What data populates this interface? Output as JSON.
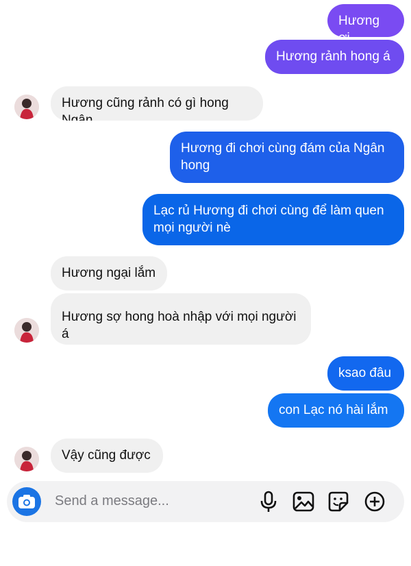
{
  "messages": [
    {
      "side": "out",
      "text": "Hương ơi",
      "color": "#7a4bf2"
    },
    {
      "side": "out",
      "text": "Hương rảnh hong á",
      "color": "#6f4cf0"
    },
    {
      "side": "in",
      "text": "Hương cũng rảnh có gì hong Ngân",
      "color": "#f0f0f0"
    },
    {
      "side": "out",
      "text": "Hương đi chơi cùng đám của Ngân hong",
      "color": "#1e60ea"
    },
    {
      "side": "out",
      "text": "Lạc rủ Hương đi chơi cùng để làm quen mọi người nè",
      "color": "#0a66e8"
    },
    {
      "side": "in",
      "text": "Hương ngại lắm",
      "color": "#f0f0f0"
    },
    {
      "side": "in",
      "text": "Hương sợ hong hoà nhập với mọi người á",
      "color": "#f0f0f0"
    },
    {
      "side": "out",
      "text": "ksao đâu",
      "color": "#1268ef"
    },
    {
      "side": "out",
      "text": "con Lạc nó hài lắm",
      "color": "#1476f2"
    },
    {
      "side": "in",
      "text": "Vậy cũng được",
      "color": "#f0f0f0"
    }
  ],
  "composer": {
    "placeholder": "Send a message...",
    "accent": "#1b74e4",
    "icons": [
      "camera-icon",
      "microphone-icon",
      "image-icon",
      "sticker-icon",
      "plus-icon"
    ]
  }
}
